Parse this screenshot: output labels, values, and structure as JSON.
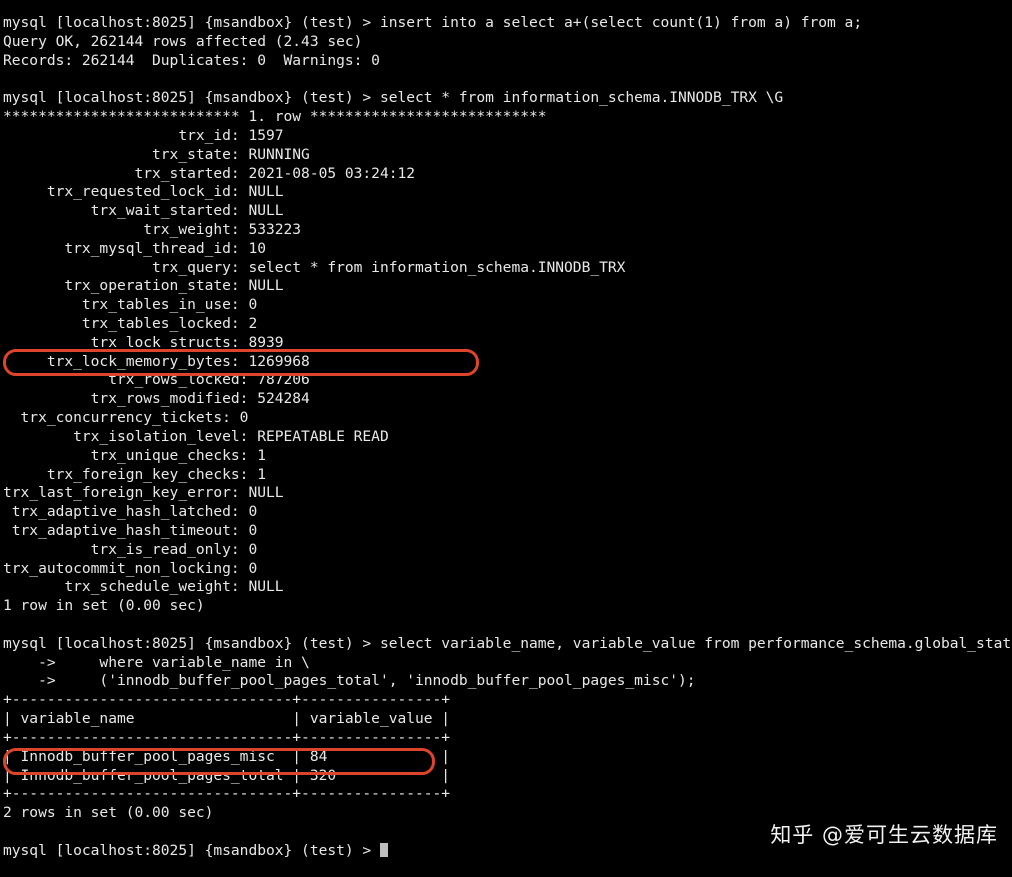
{
  "terminal": {
    "prompt": "mysql [localhost:8025] {msandbox} (test) > ",
    "continuation_prompt": "    ->     ",
    "lines": [
      "mysql [localhost:8025] {msandbox} (test) > insert into a select a+(select count(1) from a) from a;",
      "Query OK, 262144 rows affected (2.43 sec)",
      "Records: 262144  Duplicates: 0  Warnings: 0",
      "",
      "mysql [localhost:8025] {msandbox} (test) > select * from information_schema.INNODB_TRX \\G",
      "*************************** 1. row ***************************",
      "                    trx_id: 1597",
      "                 trx_state: RUNNING",
      "               trx_started: 2021-08-05 03:24:12",
      "     trx_requested_lock_id: NULL",
      "          trx_wait_started: NULL",
      "                trx_weight: 533223",
      "       trx_mysql_thread_id: 10",
      "                 trx_query: select * from information_schema.INNODB_TRX",
      "       trx_operation_state: NULL",
      "         trx_tables_in_use: 0",
      "         trx_tables_locked: 2",
      "          trx_lock_structs: 8939",
      "     trx_lock_memory_bytes: 1269968",
      "            trx_rows_locked: 787206",
      "          trx_rows_modified: 524284",
      "  trx_concurrency_tickets: 0",
      "        trx_isolation_level: REPEATABLE READ",
      "          trx_unique_checks: 1",
      "     trx_foreign_key_checks: 1",
      "trx_last_foreign_key_error: NULL",
      " trx_adaptive_hash_latched: 0",
      " trx_adaptive_hash_timeout: 0",
      "          trx_is_read_only: 0",
      "trx_autocommit_non_locking: 0",
      "       trx_schedule_weight: NULL",
      "1 row in set (0.00 sec)",
      "",
      "mysql [localhost:8025] {msandbox} (test) > select variable_name, variable_value from performance_schema.global_status \\",
      "    ->     where variable_name in \\",
      "    ->     ('innodb_buffer_pool_pages_total', 'innodb_buffer_pool_pages_misc');",
      "+--------------------------------+----------------+",
      "| variable_name                  | variable_value |",
      "+--------------------------------+----------------+",
      "| Innodb_buffer_pool_pages_misc  | 84             |",
      "| Innodb_buffer_pool_pages_total | 320            |",
      "+--------------------------------+----------------+",
      "2 rows in set (0.00 sec)",
      ""
    ],
    "final_prompt_line": "mysql [localhost:8025] {msandbox} (test) > "
  },
  "commands": [
    {
      "name": "insert-statement",
      "text": "insert into a select a+(select count(1) from a) from a;",
      "result_summary": "Query OK, 262144 rows affected (2.43 sec)",
      "result_detail": "Records: 262144  Duplicates: 0  Warnings: 0"
    },
    {
      "name": "innodb-trx-query",
      "text": "select * from information_schema.INNODB_TRX \\G",
      "row_header": "*************************** 1. row ***************************",
      "footer": "1 row in set (0.00 sec)"
    },
    {
      "name": "global-status-query",
      "line1": "select variable_name, variable_value from performance_schema.global_status \\",
      "line2": "where variable_name in \\",
      "line3": "('innodb_buffer_pool_pages_total', 'innodb_buffer_pool_pages_misc');",
      "footer": "2 rows in set (0.00 sec)"
    }
  ],
  "trx_fields": [
    {
      "key": "trx_id",
      "value": "1597"
    },
    {
      "key": "trx_state",
      "value": "RUNNING"
    },
    {
      "key": "trx_started",
      "value": "2021-08-05 03:24:12"
    },
    {
      "key": "trx_requested_lock_id",
      "value": "NULL"
    },
    {
      "key": "trx_wait_started",
      "value": "NULL"
    },
    {
      "key": "trx_weight",
      "value": "533223"
    },
    {
      "key": "trx_mysql_thread_id",
      "value": "10"
    },
    {
      "key": "trx_query",
      "value": "select * from information_schema.INNODB_TRX"
    },
    {
      "key": "trx_operation_state",
      "value": "NULL"
    },
    {
      "key": "trx_tables_in_use",
      "value": "0"
    },
    {
      "key": "trx_tables_locked",
      "value": "2"
    },
    {
      "key": "trx_lock_structs",
      "value": "8939"
    },
    {
      "key": "trx_lock_memory_bytes",
      "value": "1269968"
    },
    {
      "key": "trx_rows_locked",
      "value": "787206"
    },
    {
      "key": "trx_rows_modified",
      "value": "524284"
    },
    {
      "key": "trx_concurrency_tickets",
      "value": "0"
    },
    {
      "key": "trx_isolation_level",
      "value": "REPEATABLE READ"
    },
    {
      "key": "trx_unique_checks",
      "value": "1"
    },
    {
      "key": "trx_foreign_key_checks",
      "value": "1"
    },
    {
      "key": "trx_last_foreign_key_error",
      "value": "NULL"
    },
    {
      "key": "trx_adaptive_hash_latched",
      "value": "0"
    },
    {
      "key": "trx_adaptive_hash_timeout",
      "value": "0"
    },
    {
      "key": "trx_is_read_only",
      "value": "0"
    },
    {
      "key": "trx_autocommit_non_locking",
      "value": "0"
    },
    {
      "key": "trx_schedule_weight",
      "value": "NULL"
    }
  ],
  "result_table": {
    "columns": [
      "variable_name",
      "variable_value"
    ],
    "rows": [
      [
        "Innodb_buffer_pool_pages_misc",
        "84"
      ],
      [
        "Innodb_buffer_pool_pages_total",
        "320"
      ]
    ]
  },
  "highlights": [
    {
      "name": "trx_lock_memory_bytes-highlight",
      "color": "#dc442c",
      "target": "trx_lock_memory_bytes: 1269968"
    },
    {
      "name": "innodb_buffer_pool_pages_misc-highlight",
      "color": "#dc442c",
      "target": "Innodb_buffer_pool_pages_misc | 84"
    }
  ],
  "watermark": {
    "text": "知乎 @爱可生云数据库"
  },
  "colors": {
    "background": "#000000",
    "foreground": "#e8e8e8",
    "highlight": "#dc442c",
    "cursor": "#bdbdbd"
  }
}
